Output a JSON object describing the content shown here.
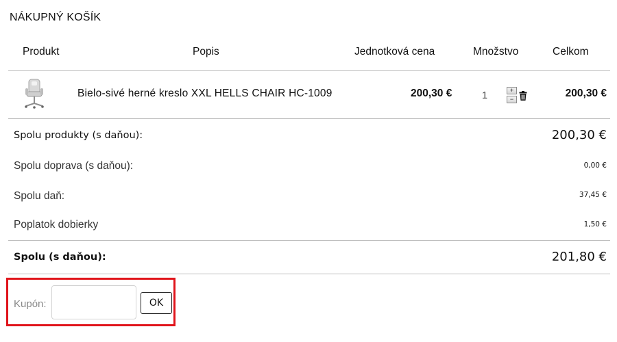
{
  "cart": {
    "title": "NÁKUPNÝ KOŠÍK",
    "columns": {
      "product": "Produkt",
      "description": "Popis",
      "unit_price": "Jednotková cena",
      "quantity": "Množstvo",
      "total": "Celkom"
    },
    "items": [
      {
        "description": "Bielo-sivé herné kreslo XXL HELLS CHAIR HC-1009",
        "unit_price": "200,30 €",
        "quantity": "1",
        "total": "200,30 €",
        "qty_plus": "+",
        "qty_minus": "−",
        "product_icon": "chair-image",
        "delete_icon": "trash-icon"
      }
    ]
  },
  "summary": {
    "products_label": "Spolu produkty (s daňou):",
    "products_value": "200,30 €",
    "shipping_label": "Spolu doprava (s daňou):",
    "shipping_value": "0,00 €",
    "tax_label": "Spolu daň:",
    "tax_value": "37,45 €",
    "cod_label": "Poplatok dobierky",
    "cod_value": "1,50 €",
    "grand_label": "Spolu (s daňou):",
    "grand_value": "201,80 €"
  },
  "coupon": {
    "label": "Kupón:",
    "value": "",
    "button": "OK",
    "highlight_color": "#e0141b"
  }
}
